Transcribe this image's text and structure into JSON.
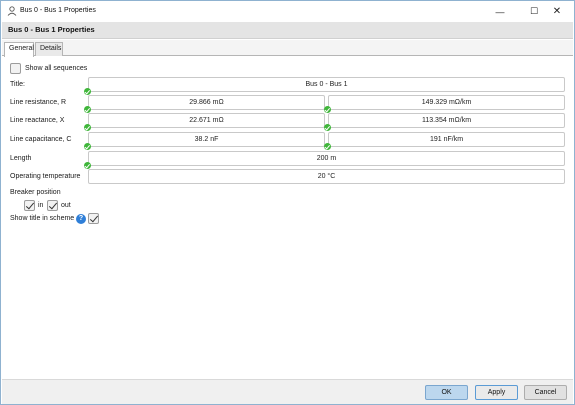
{
  "window": {
    "title": "Bus 0 - Bus 1 Properties"
  },
  "header": {
    "title": "Bus 0 - Bus 1 Properties"
  },
  "tabs": [
    {
      "label": "General"
    },
    {
      "label": "Details"
    }
  ],
  "form": {
    "show_all_sequences": {
      "label": "Show all sequences",
      "checked": false
    },
    "title": {
      "label": "Title:",
      "value": "Bus 0 - Bus 1"
    },
    "line_resistance": {
      "label": "Line resistance, R",
      "value": "29.866 mΩ",
      "per_length": "149.329 mΩ/km"
    },
    "line_reactance": {
      "label": "Line reactance, X",
      "value": "22.671 mΩ",
      "per_length": "113.354 mΩ/km"
    },
    "line_capacitance": {
      "label": "Line capacitance, C",
      "value": "38.2 nF",
      "per_length": "191 nF/km"
    },
    "length": {
      "label": "Length",
      "value": "200 m"
    },
    "operating_temperature": {
      "label": "Operating temperature",
      "value": "20 °C"
    },
    "breaker_position": {
      "label": "Breaker position",
      "in_label": "in",
      "in_checked": true,
      "out_label": "out",
      "out_checked": true
    },
    "show_title_in_scheme": {
      "label": "Show title in scheme",
      "checked": true
    }
  },
  "footer": {
    "ok_label": "OK",
    "apply_label": "Apply",
    "cancel_label": "Cancel"
  },
  "colors": {
    "valid_dot": "#3fb63a",
    "help": "#2f7fd8",
    "ok_button": "#bcd7ee"
  },
  "icons": {
    "app": "line-properties-icon",
    "minimize": "minimize-icon",
    "maximize": "maximize-icon",
    "close": "close-icon",
    "help": "help-icon",
    "valid": "check-circle-icon"
  }
}
